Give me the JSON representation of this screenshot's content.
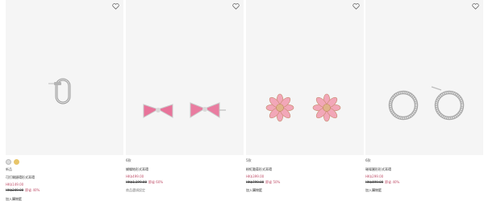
{
  "products": [
    {
      "label": "新品",
      "name": "可打開鏈環形式耳環",
      "price": "HK$149.00",
      "original": "HK$249.00",
      "discount": "節省 40%",
      "cart": "加入購物籃",
      "swatches": [
        "silver",
        "gold"
      ]
    },
    {
      "label": "6款",
      "name": "蝴蝶結形式耳環",
      "price": "HK$499.00",
      "original": "HK$1,199.00",
      "discount": "節省 60%",
      "cart": "商品選項設定"
    },
    {
      "label": "5款",
      "name": "粉紅雛菊形式耳環",
      "price": "HK$399.00",
      "original": "HK$799.00",
      "discount": "節省 50%",
      "cart": "加入購物籃"
    },
    {
      "label": "6款",
      "name": "璀璨圓形形式耳環",
      "price": "HK$299.00",
      "original": "HK$499.00",
      "discount": "節省 40%",
      "cart": "加入購物籃"
    }
  ],
  "colors": {
    "price": "#c0506a",
    "card_bg": "#f5f5f5"
  }
}
